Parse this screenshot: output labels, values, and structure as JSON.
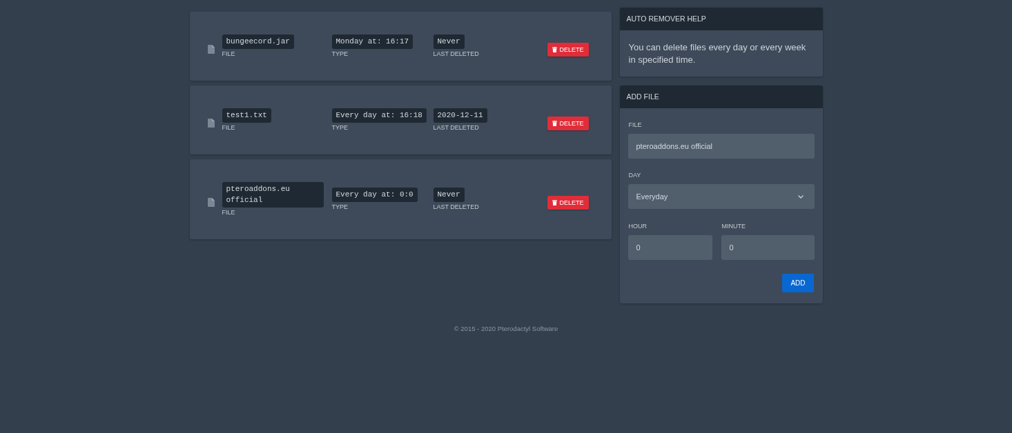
{
  "files": [
    {
      "file": "bungeecord.jar",
      "file_label": "FILE",
      "type": "Monday at: 16:17",
      "type_label": "TYPE",
      "last_deleted": "Never",
      "last_deleted_label": "LAST DELETED",
      "delete_button": "DELETE"
    },
    {
      "file": "test1.txt",
      "file_label": "FILE",
      "type": "Every day at: 16:18",
      "type_label": "TYPE",
      "last_deleted": "2020-12-11",
      "last_deleted_label": "LAST DELETED",
      "delete_button": "DELETE"
    },
    {
      "file": "pteroaddons.eu official",
      "file_label": "FILE",
      "type": "Every day at: 0:0",
      "type_label": "TYPE",
      "last_deleted": "Never",
      "last_deleted_label": "LAST DELETED",
      "delete_button": "DELETE"
    }
  ],
  "help": {
    "title": "AUTO REMOVER HELP",
    "text": "You can delete files every day or every week in specified time."
  },
  "add_file": {
    "title": "ADD FILE",
    "file_field": {
      "label": "FILE",
      "value": "pteroaddons.eu official"
    },
    "day_select": {
      "label": "DAY",
      "value": "Everyday"
    },
    "hour_field": {
      "label": "HOUR",
      "value": "0"
    },
    "minute_field": {
      "label": "MINUTE",
      "value": "0"
    },
    "add_button": "ADD"
  },
  "footer": "© 2015 - 2020 Pterodactyl Software"
}
